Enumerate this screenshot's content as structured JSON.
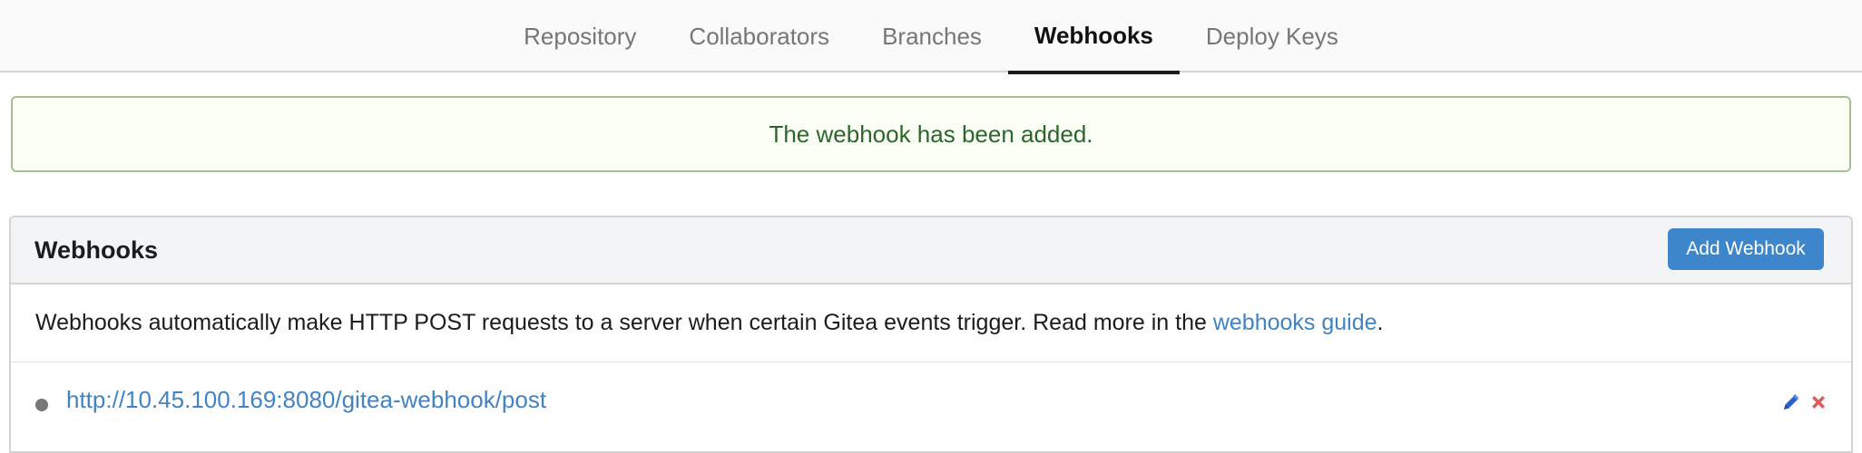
{
  "tabs": [
    {
      "label": "Repository",
      "active": false
    },
    {
      "label": "Collaborators",
      "active": false
    },
    {
      "label": "Branches",
      "active": false
    },
    {
      "label": "Webhooks",
      "active": true
    },
    {
      "label": "Deploy Keys",
      "active": false
    }
  ],
  "flash": {
    "message": "The webhook has been added."
  },
  "webhooks_panel": {
    "title": "Webhooks",
    "add_button_label": "Add Webhook",
    "description_text": "Webhooks automatically make HTTP POST requests to a server when certain Gitea events trigger. Read more in the ",
    "guide_link_text": "webhooks guide",
    "description_suffix": ".",
    "hooks": [
      {
        "url": "http://10.45.100.169:8080/gitea-webhook/post",
        "status_color": "#777777",
        "edit_icon": "pencil-icon",
        "delete_icon": "close-icon"
      }
    ]
  },
  "colors": {
    "accent": "#3d86cc",
    "link": "#4183c4",
    "success_text": "#2c662d",
    "success_bg": "#fcfff5",
    "success_border": "#a3c293",
    "edit_icon": "#2d63c8",
    "delete_icon": "#db5c5c"
  }
}
